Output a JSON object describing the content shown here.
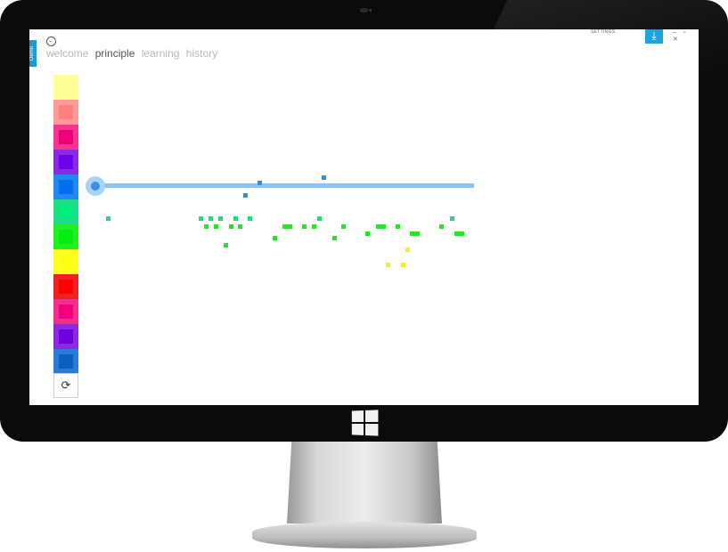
{
  "app": {
    "side_tab_label": "Demo",
    "nav": [
      "welcome",
      "principle",
      "learning",
      "history"
    ],
    "active_nav_index": 1,
    "settings_label": "SETTINGS",
    "badge_icon": "download-arrow-icon",
    "window_controls": "– ▫ ✕"
  },
  "palette": [
    {
      "outer": "#ffff99",
      "inner": "#ffff99"
    },
    {
      "outer": "#ff9a9a",
      "inner": "#ff7f7f"
    },
    {
      "outer": "#f5358f",
      "inner": "#ef007a"
    },
    {
      "outer": "#8a2be2",
      "inner": "#7000f0"
    },
    {
      "outer": "#2288ee",
      "inner": "#0070f0"
    },
    {
      "outer": "#22dd88",
      "inner": "#00f080"
    },
    {
      "outer": "#22ee22",
      "inner": "#00f010"
    },
    {
      "outer": "#ffff22",
      "inner": "#ffff10"
    },
    {
      "outer": "#ee2222",
      "inner": "#ff0000"
    },
    {
      "outer": "#f0308a",
      "inner": "#f00080"
    },
    {
      "outer": "#8a2be2",
      "inner": "#7000e0"
    },
    {
      "outer": "#2a7bd6",
      "inner": "#0a5fc0"
    }
  ],
  "refresh_icon": "refresh-icon",
  "slider": {
    "value": 0.0
  },
  "colors": {
    "accent": "#1aa3df",
    "track": "#8ec3f2",
    "blue_dot": "#2f8fe8",
    "green_dot": "#22e822",
    "mint_dot": "#22dd77",
    "yellow_dot": "#f0f022"
  }
}
